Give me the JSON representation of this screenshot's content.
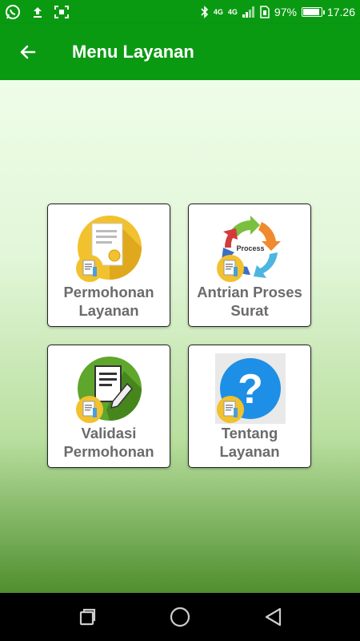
{
  "status_bar": {
    "battery_percent": "97%",
    "battery_level": 0.97,
    "time": "17.26",
    "network_left": "4G",
    "network_right": "4G",
    "icons": [
      "whatsapp-icon",
      "upload-icon",
      "screenshot-icon",
      "bluetooth-icon",
      "signal-icon",
      "sim-icon",
      "battery-icon"
    ]
  },
  "app_bar": {
    "title": "Menu Layanan",
    "back_icon": "arrow-left-icon",
    "color": "#0a9a12"
  },
  "menu": {
    "items": [
      {
        "label": "Permohonan\nLayanan",
        "icon": "document-certificate-icon"
      },
      {
        "label": "Antrian Proses\nSurat",
        "icon": "process-cycle-icon",
        "icon_text": "Process"
      },
      {
        "label": "Validasi\nPermohonan",
        "icon": "edit-document-icon"
      },
      {
        "label": "Tentang\nLayanan",
        "icon": "question-icon",
        "icon_text": "?"
      }
    ]
  },
  "nav_bar": {
    "buttons": [
      "recent-apps-icon",
      "home-icon",
      "back-icon"
    ]
  }
}
